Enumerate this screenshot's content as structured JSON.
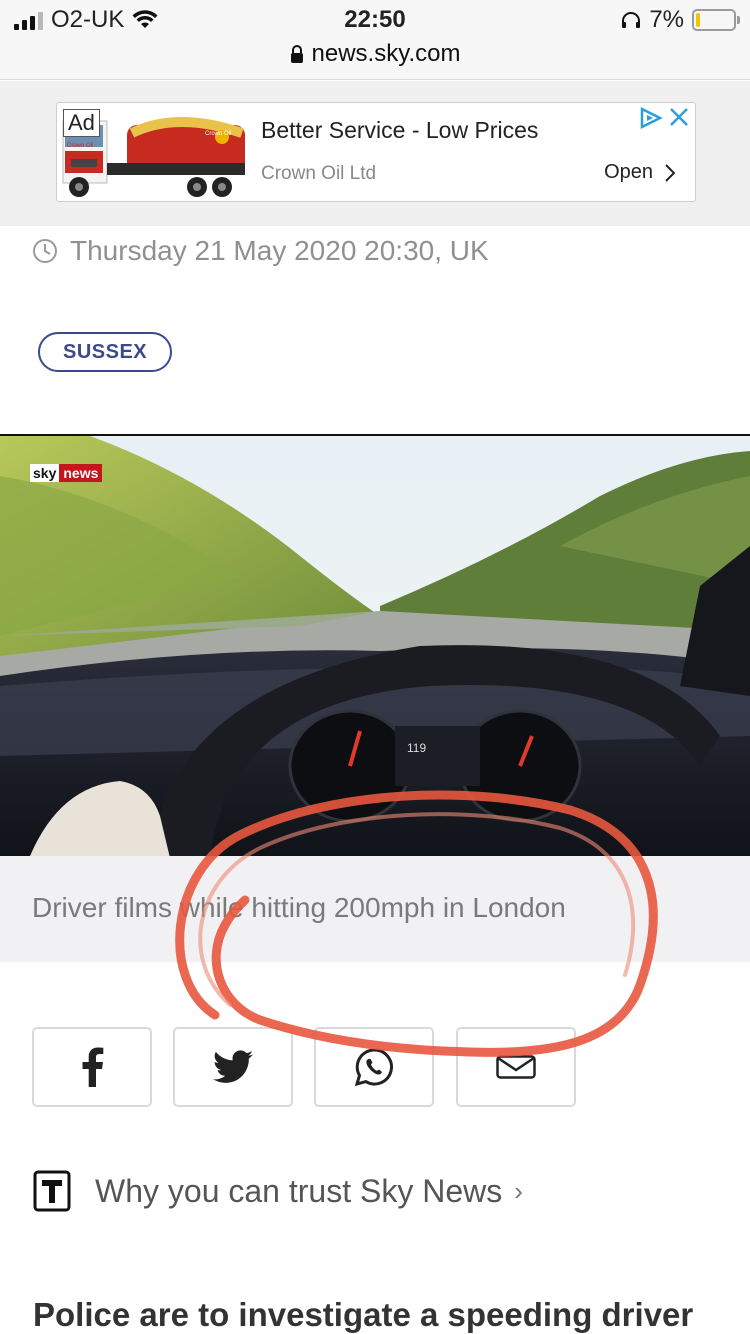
{
  "status_bar": {
    "carrier": "O2-UK",
    "time": "22:50",
    "url": "news.sky.com",
    "battery": "7%",
    "battery_level": 0.07
  },
  "ad": {
    "badge": "Ad",
    "title": "Better Service - Low Prices",
    "company": "Crown Oil Ltd",
    "open_label": "Open",
    "tanker_brand": "Crown Oil"
  },
  "article": {
    "dateline": "Thursday 21 May 2020 20:30, UK",
    "tag": "SUSSEX",
    "video_logo_sky": "sky",
    "video_logo_news": "news",
    "speedometer_reading": "119",
    "caption": "Driver films while hitting 200mph in London",
    "trust_label": "Why you can trust Sky News",
    "headline": "Police are to investigate a speeding driver"
  },
  "share": [
    {
      "name": "facebook-icon"
    },
    {
      "name": "twitter-icon"
    },
    {
      "name": "whatsapp-icon"
    },
    {
      "name": "email-icon"
    }
  ],
  "colors": {
    "tag_border": "#3a4a8a",
    "annotation": "#e8583e",
    "sky_red": "#c4161c",
    "ad_choices": "#2aa0d8"
  }
}
